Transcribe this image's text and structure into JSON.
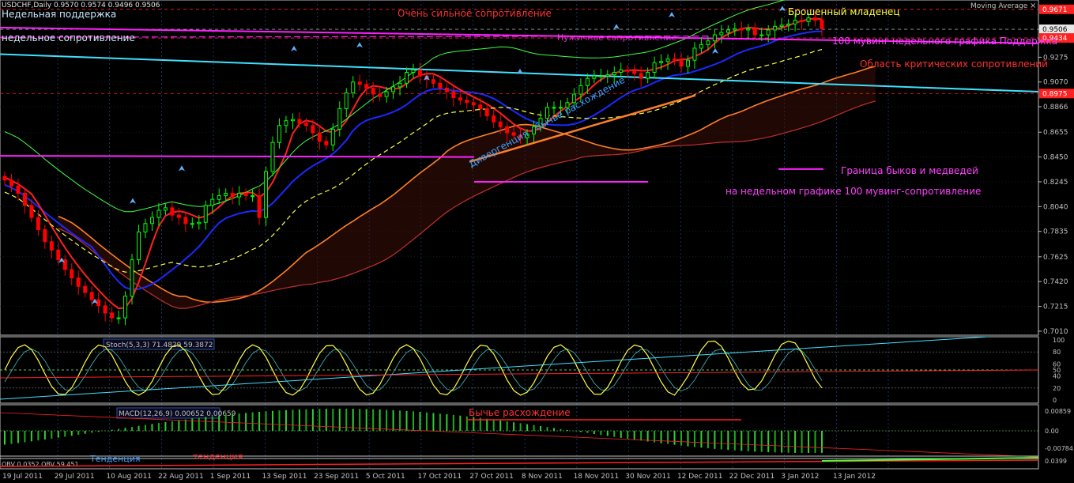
{
  "window": {
    "symbol_header": "USDCHF,Daily  0.9570 0.9574 0.9496 0.9506",
    "indicator_name": "Moving Average",
    "close_glyph": "×"
  },
  "colors": {
    "background": "#000000",
    "axis": "#c0c0c0",
    "grid": "#2f4f8f",
    "bull_candle": "#00ff00",
    "bear_candle": "#ff0000",
    "red": "#ff2020",
    "blue": "#1a2aff",
    "magenta": "#ff20ff",
    "cyan": "#40e0ff",
    "orange": "#ff7f27",
    "yellow": "#ffff40",
    "green": "#40ff40",
    "white_label": "#e0e0ff",
    "price_box_red": "#ff2020",
    "price_box_cyan": "#00c0ff"
  },
  "chart_data": {
    "type": "candlestick",
    "title": "USDCHF,Daily  0.9570 0.9574 0.9496 0.9506",
    "x_dates": [
      "19 Jul 2011",
      "29 Jul 2011",
      "10 Aug 2011",
      "22 Aug 2011",
      "1 Sep 2011",
      "13 Sep 2011",
      "23 Sep 2011",
      "5 Oct 2011",
      "17 Oct 2011",
      "27 Oct 2011",
      "8 Nov 2011",
      "18 Nov 2011",
      "30 Nov 2011",
      "12 Dec 2011",
      "22 Dec 2011",
      "3 Jan 2012",
      "13 Jan 2012"
    ],
    "price_ticks": [
      "0.9506",
      "0.9434",
      "0.9275",
      "0.9070",
      "0.8866",
      "0.8655",
      "0.8450",
      "0.8245",
      "0.8040",
      "0.7835",
      "0.7625",
      "0.7420",
      "0.7215",
      "0.7010"
    ],
    "price_markers": [
      {
        "label": "0.9671",
        "role": "high",
        "color": "red"
      },
      {
        "label": "0.9506",
        "role": "current",
        "color": "white"
      },
      {
        "label": "0.9434",
        "role": "level",
        "color": "red"
      },
      {
        "label": "0.8975",
        "role": "level",
        "color": "red"
      }
    ],
    "ylim": [
      0.699,
      0.9735
    ],
    "closes": [
      0.826,
      0.821,
      0.815,
      0.805,
      0.795,
      0.785,
      0.775,
      0.768,
      0.76,
      0.752,
      0.745,
      0.738,
      0.733,
      0.727,
      0.722,
      0.716,
      0.712,
      0.712,
      0.73,
      0.76,
      0.783,
      0.79,
      0.795,
      0.801,
      0.803,
      0.797,
      0.795,
      0.79,
      0.79,
      0.791,
      0.805,
      0.81,
      0.813,
      0.815,
      0.812,
      0.815,
      0.813,
      0.813,
      0.795,
      0.833,
      0.857,
      0.871,
      0.875,
      0.876,
      0.873,
      0.871,
      0.865,
      0.858,
      0.855,
      0.868,
      0.885,
      0.898,
      0.907,
      0.905,
      0.902,
      0.897,
      0.895,
      0.899,
      0.903,
      0.906,
      0.915,
      0.917,
      0.912,
      0.909,
      0.906,
      0.902,
      0.899,
      0.894,
      0.892,
      0.89,
      0.888,
      0.885,
      0.879,
      0.874,
      0.87,
      0.865,
      0.863,
      0.861,
      0.864,
      0.87,
      0.877,
      0.886,
      0.886,
      0.886,
      0.89,
      0.897,
      0.904,
      0.91,
      0.912,
      0.912,
      0.913,
      0.915,
      0.917,
      0.916,
      0.914,
      0.91,
      0.915,
      0.923,
      0.924,
      0.926,
      0.925,
      0.92,
      0.925,
      0.935,
      0.938,
      0.941,
      0.946,
      0.948,
      0.95,
      0.951,
      0.95,
      0.951,
      0.946,
      0.946,
      0.95,
      0.953,
      0.954,
      0.955,
      0.958,
      0.957,
      0.96,
      0.958,
      0.951
    ],
    "stochastic": {
      "label": "Stoch(5,3,3) 71.4829 59.3872",
      "levels": [
        "100",
        "80",
        "60",
        "50",
        "40",
        "20",
        "0"
      ]
    },
    "macd": {
      "label": "MACD(12,26,9) 0.00652 0.00659",
      "levels": [
        "0.00859",
        "0.00",
        "-0.00784"
      ]
    },
    "obv": {
      "label": "OBV 0.0352  OBV  59.451",
      "levels": [
        "0.0399"
      ]
    }
  },
  "annotations": {
    "weekly_support": "Недельная поддержка",
    "weekly_resistance": "недельное сопротивление",
    "very_strong_resistance": "Очень сильное сопротивление",
    "abandoned_baby": "Брошенный младенец",
    "ma100_weekly_support": "100 мувинг недельного графика Поддержка",
    "critical_resistance_zone": "Область критических сопротивлений",
    "bullish_divergence_price": "Дивергенция - бычье расхождение",
    "bull_bear_border": "Граница быков и медведей",
    "ma100_weekly_resistance": "на недельном графике 100 мувинг-сопротивление",
    "bullish_divergence_macd": "Бычье расхождение",
    "trend_left": "Тенденция",
    "trend_mid": "тенденция",
    "hidden_resistance": "Нужичное сопротивление"
  }
}
